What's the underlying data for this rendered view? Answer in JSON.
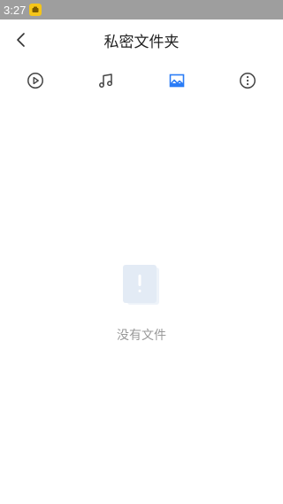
{
  "status_bar": {
    "time": "3:27",
    "app_icon": "yellow-app-icon"
  },
  "header": {
    "title": "私密文件夹",
    "back_icon": "chevron-left-icon"
  },
  "tabs": [
    {
      "name": "video",
      "icon": "play-circle-icon",
      "active": false
    },
    {
      "name": "music",
      "icon": "music-note-icon",
      "active": false
    },
    {
      "name": "image",
      "icon": "image-icon",
      "active": true
    },
    {
      "name": "more",
      "icon": "more-vertical-circle-icon",
      "active": false
    }
  ],
  "empty_state": {
    "icon": "empty-file-alert-icon",
    "message": "没有文件"
  },
  "colors": {
    "status_bar_bg": "#9e9e9e",
    "active_tab": "#2b7cf6",
    "inactive_tab": "#444444",
    "empty_text": "#999999",
    "empty_illustration": "#e3ebf5"
  }
}
